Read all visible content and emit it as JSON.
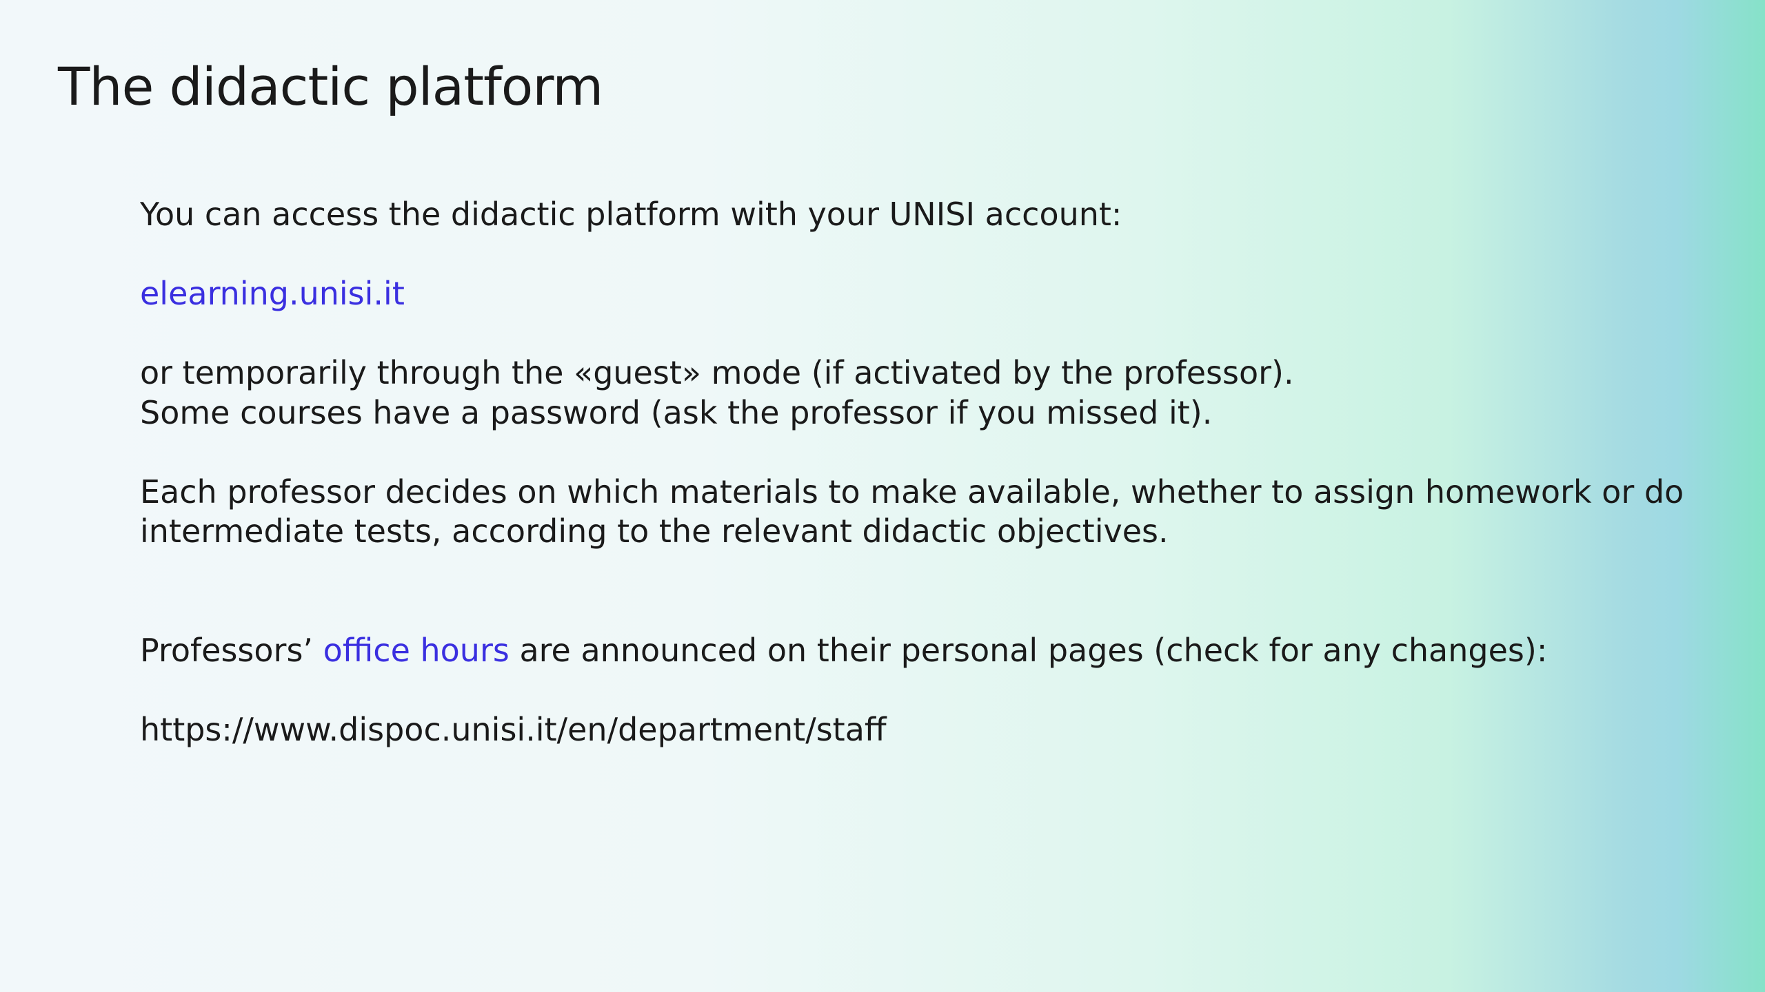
{
  "slide": {
    "title": "The didactic platform",
    "access_intro": "You can access the didactic platform with your UNISI account:",
    "elearning_link": "elearning.unisi.it",
    "guest_mode_line": "or temporarily through the «guest» mode (if activated by the professor).",
    "password_line": "Some courses have a password (ask the professor if you missed it).",
    "materials_line_1": "Each professor decides on which materials to make available, whether to assign homework or do",
    "materials_line_2": "intermediate tests, according to the relevant didactic objectives.",
    "office_hours_prefix": "Professors’ ",
    "office_hours_link": "office hours",
    "office_hours_suffix": " are announced on their personal pages (check for any changes):",
    "staff_url": "https://www.dispoc.unisi.it/en/department/staff"
  },
  "colors": {
    "text": "#1a1a1a",
    "link": "#3a2fe0",
    "background_left": "#f2f8fa",
    "background_right": "#86e2c8"
  }
}
